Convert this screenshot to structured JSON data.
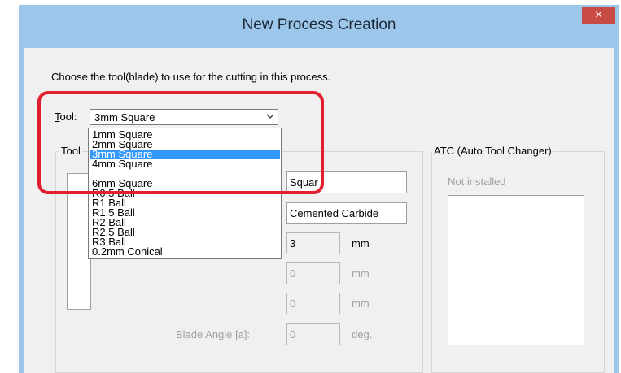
{
  "window": {
    "title": "New Process Creation",
    "close_glyph": "×"
  },
  "instruction": "Choose the tool(blade) to use for the cutting in this process.",
  "tool": {
    "label_accel": "T",
    "label_rest": "ool:",
    "selected": "3mm Square",
    "options": [
      "1mm Square",
      "2mm Square",
      "3mm Square",
      "4mm Square",
      "6mm Square",
      "R0.5 Ball",
      "R1 Ball",
      "R1.5 Ball",
      "R2 Ball",
      "R2.5 Ball",
      "R3 Ball",
      "0.2mm Conical"
    ]
  },
  "tool_group": {
    "title": "Tool",
    "shape_value": "Squar",
    "material_value": "Cemented Carbide",
    "diameter_value": "3",
    "diameter_unit": "mm",
    "field2_value": "0",
    "field2_unit": "mm",
    "field3_value": "0",
    "field3_unit": "mm",
    "blade_angle_label": "Blade Angle [a]:",
    "blade_angle_value": "0",
    "blade_angle_unit": "deg."
  },
  "atc": {
    "title": "ATC (Auto Tool Changer)",
    "status": "Not installed"
  },
  "colors": {
    "titlebar": "#9cc6ea",
    "close_button": "#c84c45",
    "selection": "#3399ff",
    "highlight": "#e02030"
  },
  "icons": {
    "dropdown": "chevron-down-icon",
    "close": "close-icon"
  }
}
